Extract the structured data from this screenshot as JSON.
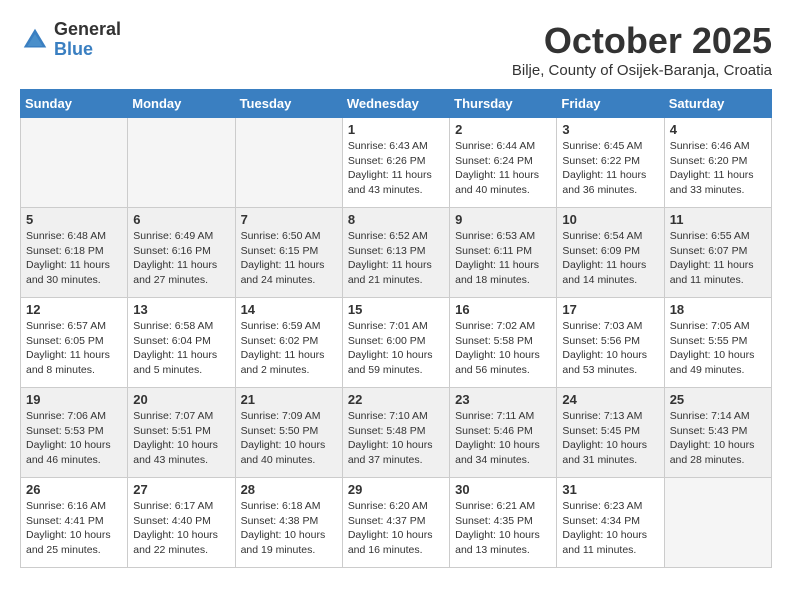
{
  "header": {
    "logo_general": "General",
    "logo_blue": "Blue",
    "month_title": "October 2025",
    "subtitle": "Bilje, County of Osijek-Baranja, Croatia"
  },
  "weekdays": [
    "Sunday",
    "Monday",
    "Tuesday",
    "Wednesday",
    "Thursday",
    "Friday",
    "Saturday"
  ],
  "weeks": [
    [
      {
        "day": "",
        "info": ""
      },
      {
        "day": "",
        "info": ""
      },
      {
        "day": "",
        "info": ""
      },
      {
        "day": "1",
        "info": "Sunrise: 6:43 AM\nSunset: 6:26 PM\nDaylight: 11 hours\nand 43 minutes."
      },
      {
        "day": "2",
        "info": "Sunrise: 6:44 AM\nSunset: 6:24 PM\nDaylight: 11 hours\nand 40 minutes."
      },
      {
        "day": "3",
        "info": "Sunrise: 6:45 AM\nSunset: 6:22 PM\nDaylight: 11 hours\nand 36 minutes."
      },
      {
        "day": "4",
        "info": "Sunrise: 6:46 AM\nSunset: 6:20 PM\nDaylight: 11 hours\nand 33 minutes."
      }
    ],
    [
      {
        "day": "5",
        "info": "Sunrise: 6:48 AM\nSunset: 6:18 PM\nDaylight: 11 hours\nand 30 minutes."
      },
      {
        "day": "6",
        "info": "Sunrise: 6:49 AM\nSunset: 6:16 PM\nDaylight: 11 hours\nand 27 minutes."
      },
      {
        "day": "7",
        "info": "Sunrise: 6:50 AM\nSunset: 6:15 PM\nDaylight: 11 hours\nand 24 minutes."
      },
      {
        "day": "8",
        "info": "Sunrise: 6:52 AM\nSunset: 6:13 PM\nDaylight: 11 hours\nand 21 minutes."
      },
      {
        "day": "9",
        "info": "Sunrise: 6:53 AM\nSunset: 6:11 PM\nDaylight: 11 hours\nand 18 minutes."
      },
      {
        "day": "10",
        "info": "Sunrise: 6:54 AM\nSunset: 6:09 PM\nDaylight: 11 hours\nand 14 minutes."
      },
      {
        "day": "11",
        "info": "Sunrise: 6:55 AM\nSunset: 6:07 PM\nDaylight: 11 hours\nand 11 minutes."
      }
    ],
    [
      {
        "day": "12",
        "info": "Sunrise: 6:57 AM\nSunset: 6:05 PM\nDaylight: 11 hours\nand 8 minutes."
      },
      {
        "day": "13",
        "info": "Sunrise: 6:58 AM\nSunset: 6:04 PM\nDaylight: 11 hours\nand 5 minutes."
      },
      {
        "day": "14",
        "info": "Sunrise: 6:59 AM\nSunset: 6:02 PM\nDaylight: 11 hours\nand 2 minutes."
      },
      {
        "day": "15",
        "info": "Sunrise: 7:01 AM\nSunset: 6:00 PM\nDaylight: 10 hours\nand 59 minutes."
      },
      {
        "day": "16",
        "info": "Sunrise: 7:02 AM\nSunset: 5:58 PM\nDaylight: 10 hours\nand 56 minutes."
      },
      {
        "day": "17",
        "info": "Sunrise: 7:03 AM\nSunset: 5:56 PM\nDaylight: 10 hours\nand 53 minutes."
      },
      {
        "day": "18",
        "info": "Sunrise: 7:05 AM\nSunset: 5:55 PM\nDaylight: 10 hours\nand 49 minutes."
      }
    ],
    [
      {
        "day": "19",
        "info": "Sunrise: 7:06 AM\nSunset: 5:53 PM\nDaylight: 10 hours\nand 46 minutes."
      },
      {
        "day": "20",
        "info": "Sunrise: 7:07 AM\nSunset: 5:51 PM\nDaylight: 10 hours\nand 43 minutes."
      },
      {
        "day": "21",
        "info": "Sunrise: 7:09 AM\nSunset: 5:50 PM\nDaylight: 10 hours\nand 40 minutes."
      },
      {
        "day": "22",
        "info": "Sunrise: 7:10 AM\nSunset: 5:48 PM\nDaylight: 10 hours\nand 37 minutes."
      },
      {
        "day": "23",
        "info": "Sunrise: 7:11 AM\nSunset: 5:46 PM\nDaylight: 10 hours\nand 34 minutes."
      },
      {
        "day": "24",
        "info": "Sunrise: 7:13 AM\nSunset: 5:45 PM\nDaylight: 10 hours\nand 31 minutes."
      },
      {
        "day": "25",
        "info": "Sunrise: 7:14 AM\nSunset: 5:43 PM\nDaylight: 10 hours\nand 28 minutes."
      }
    ],
    [
      {
        "day": "26",
        "info": "Sunrise: 6:16 AM\nSunset: 4:41 PM\nDaylight: 10 hours\nand 25 minutes."
      },
      {
        "day": "27",
        "info": "Sunrise: 6:17 AM\nSunset: 4:40 PM\nDaylight: 10 hours\nand 22 minutes."
      },
      {
        "day": "28",
        "info": "Sunrise: 6:18 AM\nSunset: 4:38 PM\nDaylight: 10 hours\nand 19 minutes."
      },
      {
        "day": "29",
        "info": "Sunrise: 6:20 AM\nSunset: 4:37 PM\nDaylight: 10 hours\nand 16 minutes."
      },
      {
        "day": "30",
        "info": "Sunrise: 6:21 AM\nSunset: 4:35 PM\nDaylight: 10 hours\nand 13 minutes."
      },
      {
        "day": "31",
        "info": "Sunrise: 6:23 AM\nSunset: 4:34 PM\nDaylight: 10 hours\nand 11 minutes."
      },
      {
        "day": "",
        "info": ""
      }
    ]
  ]
}
